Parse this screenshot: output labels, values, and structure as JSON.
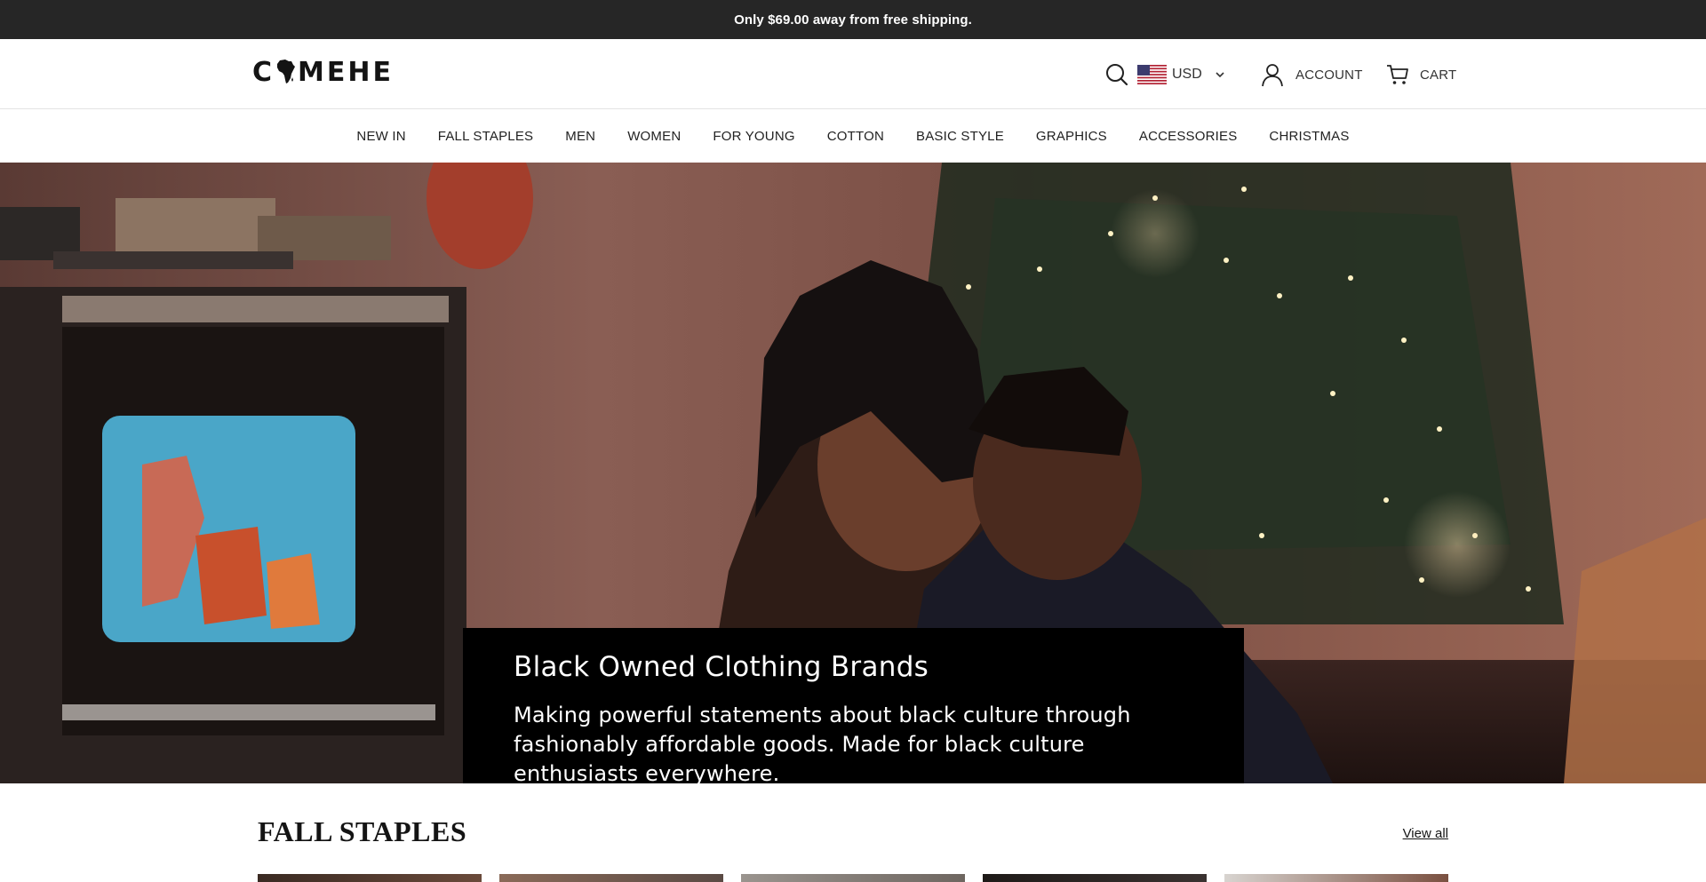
{
  "announcement": {
    "text": "Only $69.00 away from free shipping."
  },
  "header": {
    "logo_text_left": "C",
    "logo_text_right": "MEHE",
    "currency_code": "USD",
    "account_label": "ACCOUNT",
    "cart_label": "CART"
  },
  "nav": {
    "items": [
      {
        "label": "NEW IN"
      },
      {
        "label": "FALL STAPLES"
      },
      {
        "label": "MEN"
      },
      {
        "label": "WOMEN"
      },
      {
        "label": "FOR YOUNG"
      },
      {
        "label": "COTTON"
      },
      {
        "label": "BASIC STYLE"
      },
      {
        "label": "GRAPHICS"
      },
      {
        "label": "ACCESSORIES"
      },
      {
        "label": "CHRISTMAS"
      }
    ]
  },
  "hero": {
    "title": "Black Owned Clothing Brands",
    "text": "Making powerful statements about black culture through fashionably affordable goods. Made for black culture enthusiasts everywhere."
  },
  "section": {
    "title": "FALL STAPLES",
    "view_all": "View all"
  },
  "colors": {
    "announcement_bg": "#262626",
    "hero_caption_bg": "#000000",
    "text_dark": "#141414"
  },
  "icons": [
    "search-icon",
    "us-flag-icon",
    "chevron-down-icon",
    "account-icon",
    "cart-icon",
    "africa-logo-icon"
  ]
}
